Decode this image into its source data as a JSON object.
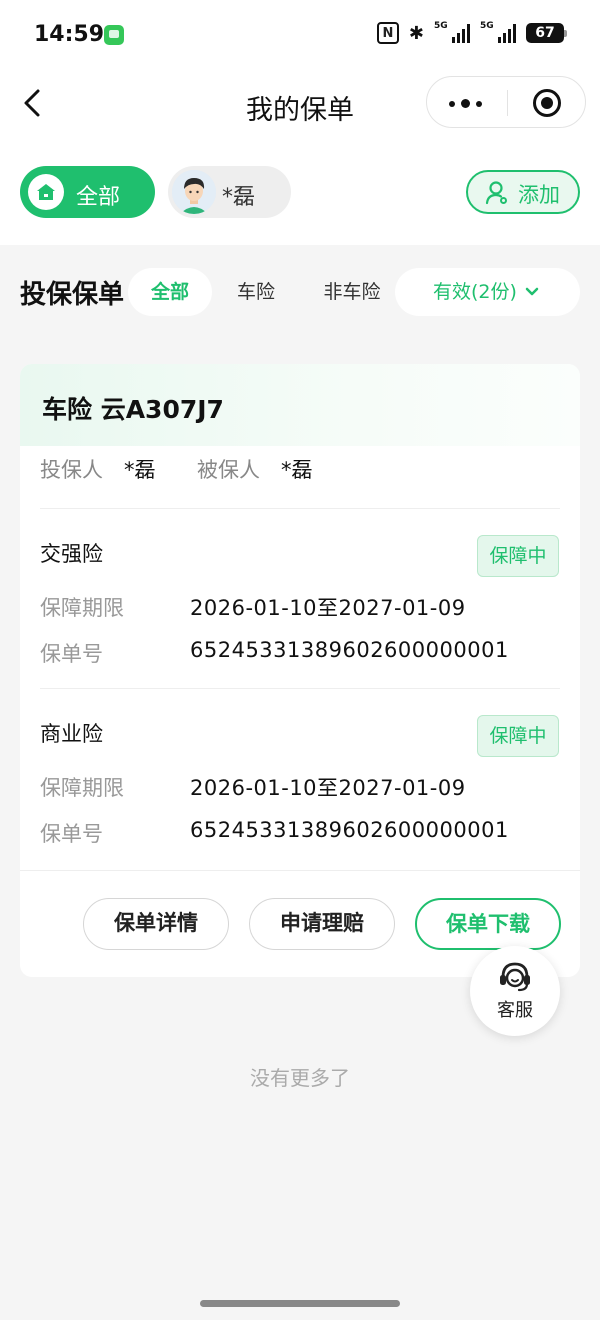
{
  "status_bar": {
    "time": "14:59",
    "nfc": "N",
    "signal1_label": "5G",
    "signal2_label": "5G",
    "battery": "67"
  },
  "nav": {
    "title": "我的保单"
  },
  "people_filter": {
    "all_label": "全部",
    "user_label": "*磊",
    "add_label": "添加"
  },
  "policy_filter": {
    "title": "投保保单",
    "tabs": [
      {
        "label": "全部",
        "active": true
      },
      {
        "label": "车险",
        "active": false
      },
      {
        "label": "非车险",
        "active": false
      }
    ],
    "status_select": "有效(2份)"
  },
  "policy_card": {
    "title": "车险 云A307J7",
    "applicant_label": "投保人",
    "applicant": "*磊",
    "insured_label": "被保人",
    "insured": "*磊",
    "sections": [
      {
        "name": "交强险",
        "status": "保障中",
        "period_label": "保障期限",
        "period": "2026-01-10至2027-01-09",
        "number_label": "保单号",
        "number": "65245331389602600000001"
      },
      {
        "name": "商业险",
        "status": "保障中",
        "period_label": "保障期限",
        "period": "2026-01-10至2027-01-09",
        "number_label": "保单号",
        "number": "65245331389602600000001"
      }
    ],
    "actions": {
      "detail": "保单详情",
      "claim": "申请理赔",
      "download": "保单下载"
    }
  },
  "customer_service": {
    "label": "客服"
  },
  "footer": {
    "no_more": "没有更多了"
  },
  "colors": {
    "accent": "#1fbf6e",
    "background": "#f5f5f5"
  }
}
